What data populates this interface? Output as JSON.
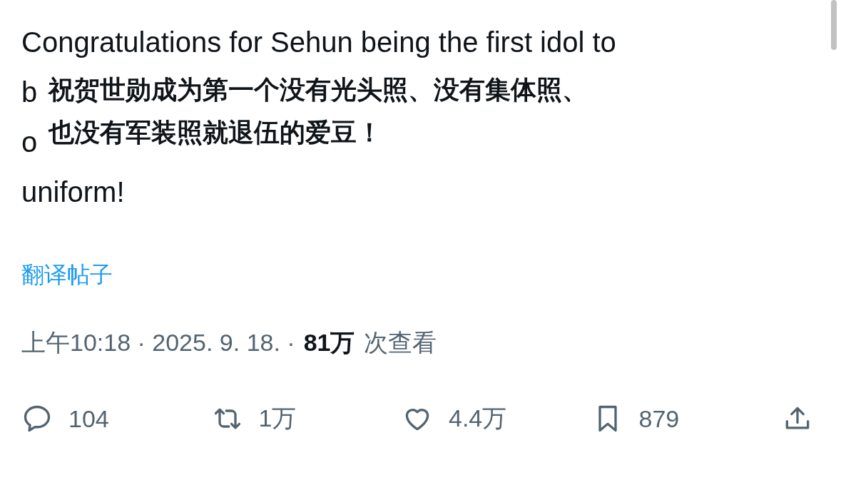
{
  "post": {
    "text_lines": [
      "Congratulations for Sehun being the first idol to",
      "b",
      "o",
      "uniform!"
    ],
    "overlay_caption": [
      "祝贺世勋成为第一个没有光头照、没有集体照、",
      "也没有军装照就退伍的爱豆！"
    ],
    "translate_link": "翻译帖子",
    "timestamp": "上午10:18 · 2025. 9. 18. ·",
    "views_count": "81万",
    "views_label": "次查看",
    "actions": [
      {
        "kind": "reply",
        "count": "104"
      },
      {
        "kind": "repost",
        "count": "1万"
      },
      {
        "kind": "like",
        "count": "4.4万"
      },
      {
        "kind": "bookmark",
        "count": "879"
      },
      {
        "kind": "share"
      }
    ]
  }
}
